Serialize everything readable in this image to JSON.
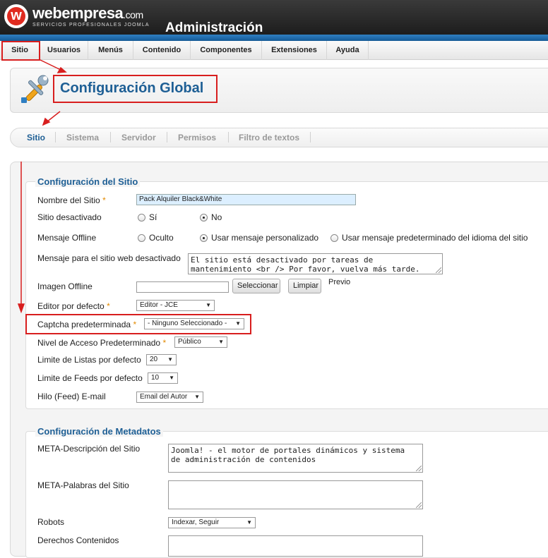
{
  "header": {
    "logo_letter": "w",
    "logo_name": "webempresa",
    "logo_tld": ".com",
    "logo_tagline": "SERVICIOS PROFESIONALES JOOMLA",
    "title": "Administración",
    "accent_color": "#1f6fb2"
  },
  "menu": {
    "items": [
      {
        "label": "Sitio"
      },
      {
        "label": "Usuarios"
      },
      {
        "label": "Menús"
      },
      {
        "label": "Contenido"
      },
      {
        "label": "Componentes"
      },
      {
        "label": "Extensiones"
      },
      {
        "label": "Ayuda"
      }
    ]
  },
  "toolbar": {
    "icon": "tools-icon",
    "page_title": "Configuración Global"
  },
  "tabs": {
    "items": [
      {
        "label": "Sitio"
      },
      {
        "label": "Sistema"
      },
      {
        "label": "Servidor"
      },
      {
        "label": "Permisos"
      },
      {
        "label": "Filtro de textos"
      }
    ],
    "active": "Sitio"
  },
  "site_config": {
    "legend": "Configuración del Sitio",
    "site_name": {
      "label": "Nombre del Sitio",
      "required": "*",
      "value": "Pack Alquiler Black&White"
    },
    "offline": {
      "label": "Sitio desactivado",
      "options": [
        "Sí",
        "No"
      ],
      "selected": "No"
    },
    "offline_message": {
      "label": "Mensaje Offline",
      "options": [
        "Oculto",
        "Usar mensaje personalizado",
        "Usar mensaje predeterminado del idioma del sitio"
      ],
      "selected": "Usar mensaje personalizado"
    },
    "offline_text": {
      "label": "Mensaje para el sitio web desactivado",
      "value": "El sitio está desactivado por tareas de\nmantenimiento <br /> Por favor, vuelva más tarde."
    },
    "offline_image": {
      "label": "Imagen Offline",
      "select_button": "Seleccionar",
      "clear_button": "Limpiar",
      "preview": "Previo"
    },
    "editor": {
      "label": "Editor por defecto",
      "required": "*",
      "value": "Editor - JCE"
    },
    "captcha": {
      "label": "Captcha predeterminada",
      "required": "*",
      "value": "- Ninguno Seleccionado -"
    },
    "access": {
      "label": "Nivel de Acceso Predeterminado",
      "required": "*",
      "value": "Público"
    },
    "list_limit": {
      "label": "Limite de Listas por defecto",
      "value": "20"
    },
    "feed_limit": {
      "label": "Limite de Feeds por defecto",
      "value": "10"
    },
    "feed_email": {
      "label": "Hilo (Feed) E-mail",
      "value": "Email del Autor"
    }
  },
  "metadata": {
    "legend": "Configuración de Metadatos",
    "meta_description": {
      "label": "META-Descripción del Sitio",
      "value": "Joomla! - el motor de portales dinámicos y sistema\nde administración de contenidos"
    },
    "meta_keywords": {
      "label": "META-Palabras del Sitio",
      "value": ""
    },
    "robots": {
      "label": "Robots",
      "value": "Indexar, Seguir"
    },
    "rights": {
      "label": "Derechos Contenidos",
      "value": ""
    }
  },
  "annotation_color": "#d81e1e",
  "dropdown_arrow": "▼"
}
